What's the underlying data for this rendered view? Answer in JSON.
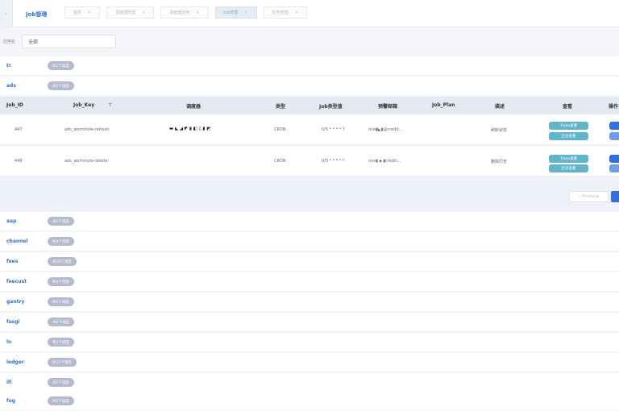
{
  "app": {
    "title": "Job管理"
  },
  "tabs": [
    {
      "label": "首页",
      "active": false
    },
    {
      "label": "调度器管理",
      "active": false
    },
    {
      "label": "调度器应用",
      "active": false
    },
    {
      "label": "Job管理",
      "active": true
    },
    {
      "label": "任务管理",
      "active": false
    }
  ],
  "filter": {
    "label": "应用名",
    "value": "全部"
  },
  "groups_top": [
    {
      "name": "tr",
      "badge": "共1个调度"
    },
    {
      "name": "ads",
      "badge": "共2个调度"
    }
  ],
  "table": {
    "headers": [
      "Job_ID",
      "Job_Key",
      "调度器",
      "类型",
      "Job类型值",
      "预警邮箱",
      "Job_Plan",
      "描述",
      "查看",
      "操作"
    ],
    "rows": [
      {
        "id": "447",
        "key": "ads_wormhole-refresh",
        "scheduler": "▬ ◣ ◢ ◤ ▮ ◧ ▯ ▮ ◩",
        "type": "CRON",
        "value": "0/5 * * * * ?",
        "email": "ove▮◣▮@credit...",
        "plan": "",
        "desc": "刷新状态",
        "view1": "Trade查看",
        "view2": "历史查看"
      },
      {
        "id": "448",
        "key": "ads_wormhole-delete",
        "scheduler": "",
        "type": "CRON",
        "value": "0/5 * * * * ?",
        "email": "ove▮ ▪ ▮credit...",
        "plan": "",
        "desc": "删除历史",
        "view1": "Trade查看",
        "view2": "历史查看"
      }
    ],
    "pager_prev": "‹ Previous"
  },
  "groups_bottom": [
    {
      "name": "aap",
      "badge": "共1个调度"
    },
    {
      "name": "channel",
      "badge": "共4个调度"
    },
    {
      "name": "fees",
      "badge": "共10个调度"
    },
    {
      "name": "feecust",
      "badge": "共4个调度"
    },
    {
      "name": "gantry",
      "badge": "共3个调度"
    },
    {
      "name": "fsegi",
      "badge": "共3个调度"
    },
    {
      "name": "lo",
      "badge": "共2个调度"
    },
    {
      "name": "ledger",
      "badge": "共11个调度"
    },
    {
      "name": "ill",
      "badge": "共1个调度"
    },
    {
      "name": "fog",
      "badge": "共2个调度"
    }
  ],
  "colors": {
    "accent": "#2b6fe0",
    "badge": "#b4bbcf",
    "teal": "#5fb6cc"
  }
}
